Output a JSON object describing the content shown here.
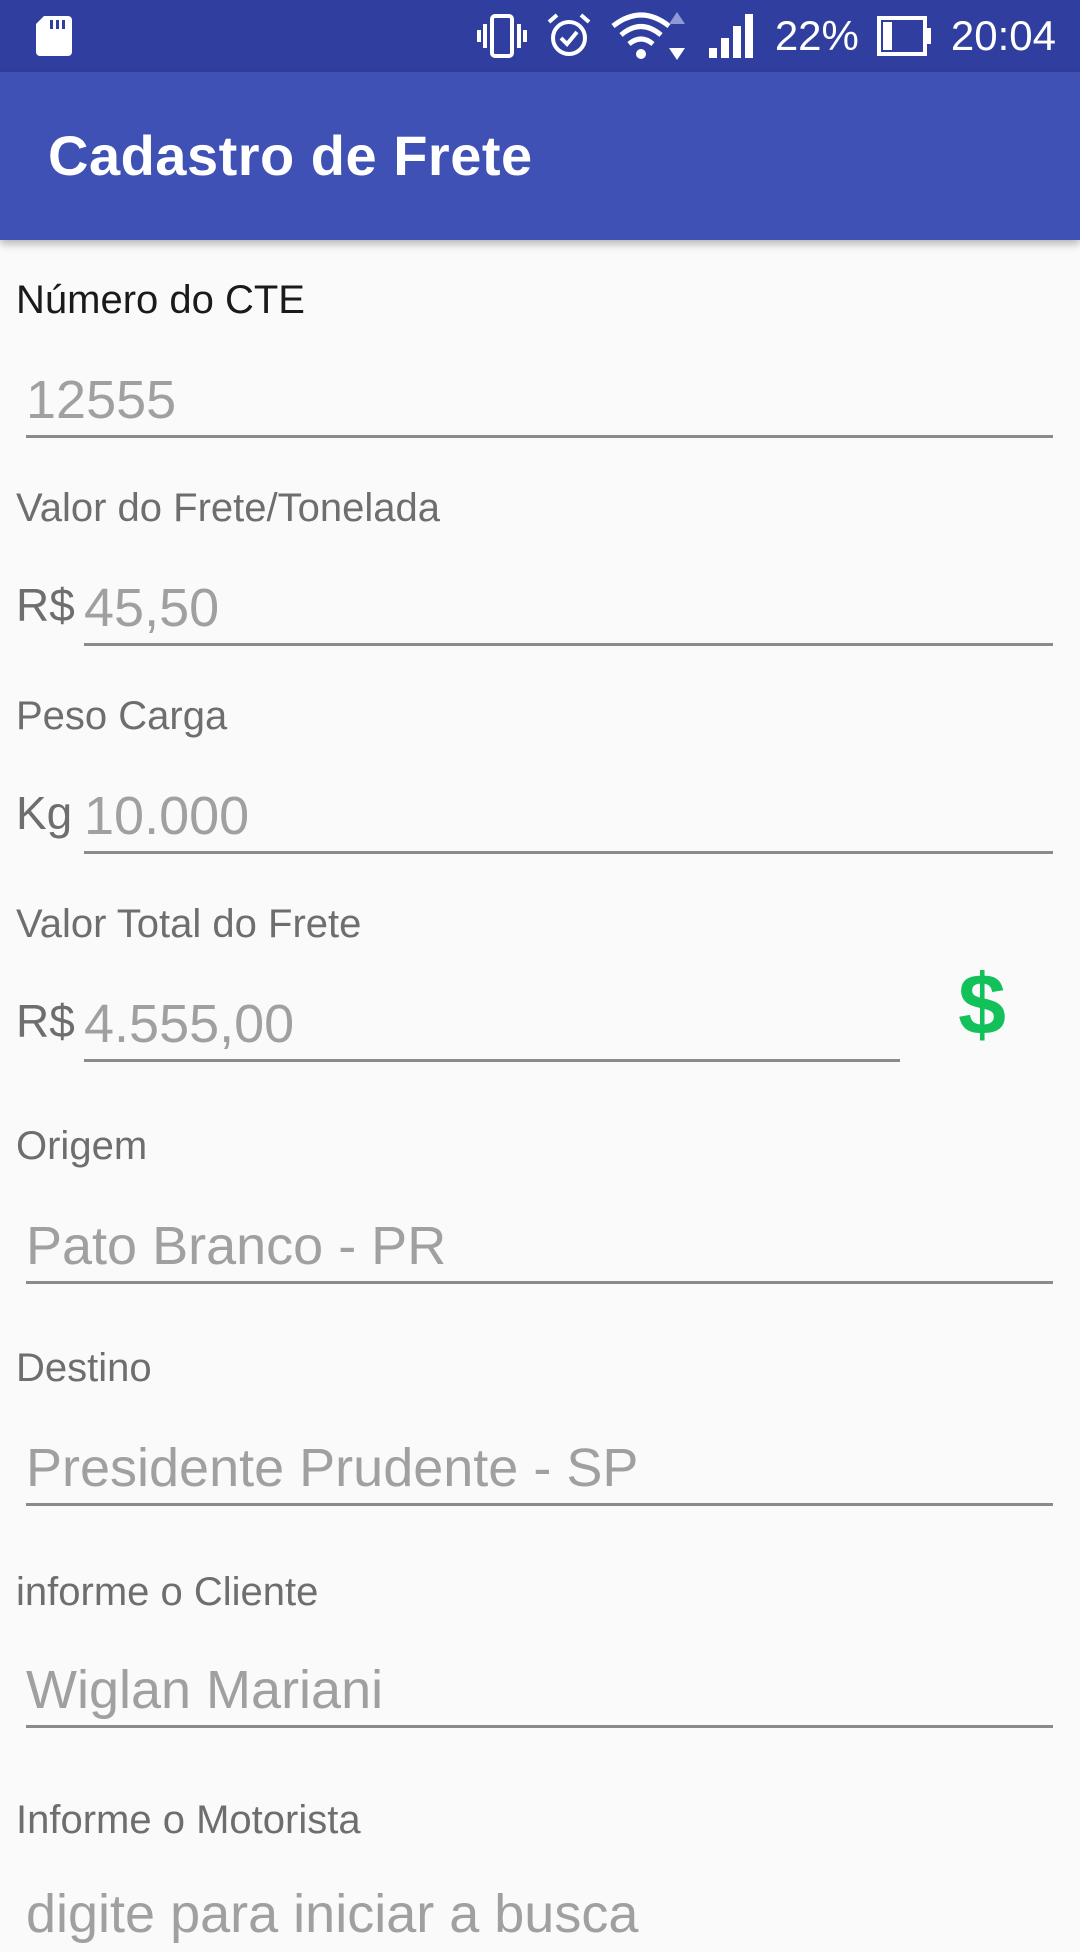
{
  "status_bar": {
    "battery_percent": "22%",
    "time": "20:04",
    "icons": [
      "sd-card-icon",
      "vibrate-icon",
      "alarm-icon",
      "wifi-icon",
      "signal-icon",
      "battery-icon"
    ]
  },
  "app_bar": {
    "title": "Cadastro de Frete"
  },
  "form": {
    "cte": {
      "label": "Número do CTE",
      "value": "12555"
    },
    "valor_frete_tonelada": {
      "label": "Valor do Frete/Tonelada",
      "prefix": "R$",
      "value": "45,50"
    },
    "peso_carga": {
      "label": "Peso Carga",
      "prefix": "Kg",
      "value": "10.000"
    },
    "valor_total": {
      "label": "Valor Total do Frete",
      "prefix": "R$",
      "value": "4.555,00",
      "action_symbol": "$"
    },
    "origem": {
      "label": "Origem",
      "value": "Pato Branco - PR"
    },
    "destino": {
      "label": "Destino",
      "value": "Presidente Prudente - SP"
    },
    "cliente": {
      "label": "informe o Cliente",
      "value": "Wiglan Mariani"
    },
    "motorista": {
      "label": "Informe o Motorista",
      "placeholder": "digite para iniciar a busca"
    }
  },
  "colors": {
    "status_bar": "#303f9f",
    "app_bar": "#3f51b5",
    "background": "#fafafa",
    "accent_dollar": "#13c15b"
  }
}
